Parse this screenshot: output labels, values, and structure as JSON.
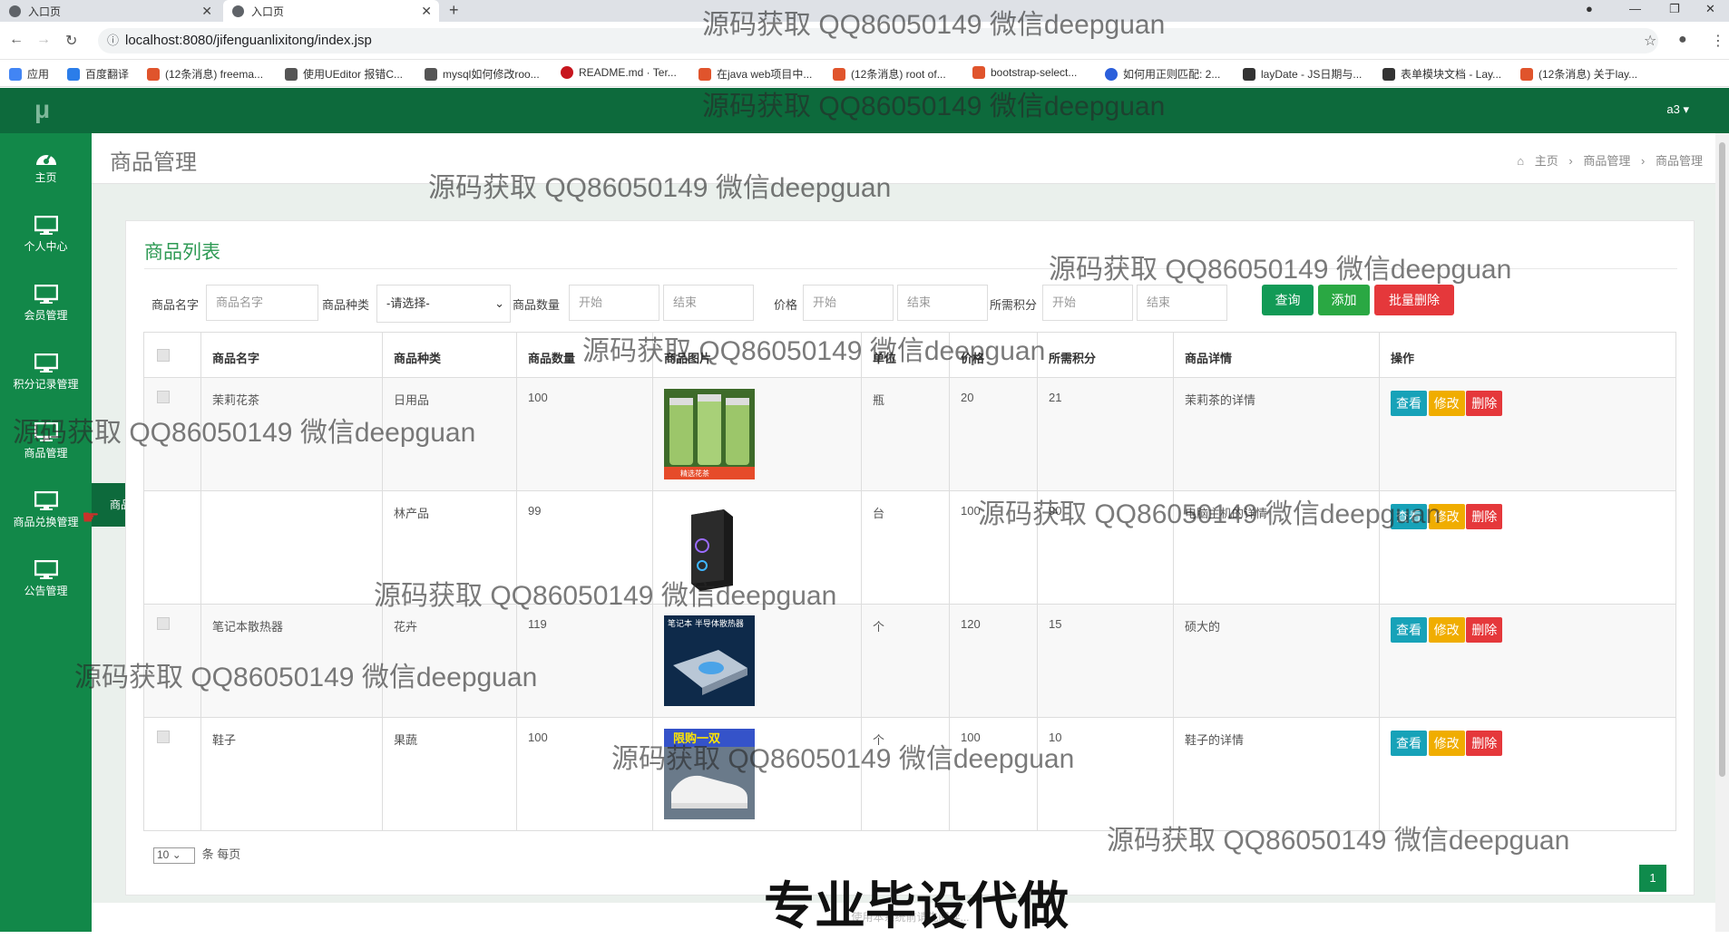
{
  "browser": {
    "tabs": [
      {
        "label": "入口页"
      },
      {
        "label": "入口页"
      }
    ],
    "url": "localhost:8080/jifenguanlixitong/index.jsp",
    "bookmarks": [
      {
        "label": "应用"
      },
      {
        "label": "百度翻译"
      },
      {
        "label": "(12条消息) freema..."
      },
      {
        "label": "使用UEditor 报错C..."
      },
      {
        "label": "mysql如何修改roo..."
      },
      {
        "label": "README.md · Ter..."
      },
      {
        "label": "在java web项目中..."
      },
      {
        "label": "(12条消息) root of..."
      },
      {
        "label": "bootstrap-select..."
      },
      {
        "label": "如何用正则匹配: 2..."
      },
      {
        "label": "layDate - JS日期与..."
      },
      {
        "label": "表单模块文档 - Lay..."
      },
      {
        "label": "(12条消息) 关于lay..."
      }
    ]
  },
  "app": {
    "logo": "μ",
    "user": "a3 ▾",
    "sidebar": [
      {
        "label": "主页",
        "icon": "dashboard-icon"
      },
      {
        "label": "个人中心",
        "icon": "monitor-icon"
      },
      {
        "label": "会员管理",
        "icon": "monitor-icon"
      },
      {
        "label": "积分记录管理",
        "icon": "monitor-icon"
      },
      {
        "label": "商品管理",
        "icon": "monitor-icon"
      },
      {
        "label": "商品兑换管理",
        "icon": "monitor-icon"
      },
      {
        "label": "公告管理",
        "icon": "monitor-icon"
      }
    ],
    "flyout": "商品兑换管理",
    "page_title": "商品管理",
    "breadcrumb": [
      "主页",
      "商品管理",
      "商品管理"
    ]
  },
  "panel": {
    "title": "商品列表",
    "filters": {
      "name_label": "商品名字",
      "name_placeholder": "商品名字",
      "type_label": "商品种类",
      "type_value": "-请选择-",
      "qty_label": "商品数量",
      "price_label": "价格",
      "points_label": "所需积分",
      "start": "开始",
      "end": "结束"
    },
    "buttons": {
      "query": "查询",
      "add": "添加",
      "batch_delete": "批量删除"
    },
    "columns": [
      "商品名字",
      "商品种类",
      "商品数量",
      "商品图片",
      "单位",
      "价格",
      "所需积分",
      "商品详情",
      "操作"
    ],
    "rows": [
      {
        "name": "茉莉花茶",
        "type": "日用品",
        "qty": "100",
        "image": "jar-image",
        "unit": "瓶",
        "price": "20",
        "points": "21",
        "detail": "茉莉茶的详情"
      },
      {
        "name": "",
        "type": "林产品",
        "qty": "99",
        "image": "pc-case-image",
        "unit": "台",
        "price": "100",
        "points": "90",
        "detail": "电脑主机的详情"
      },
      {
        "name": "笔记本散热器",
        "type": "花卉",
        "qty": "119",
        "image": "cooler-image",
        "unit": "个",
        "price": "120",
        "points": "15",
        "detail": "硕大的"
      },
      {
        "name": "鞋子",
        "type": "果蔬",
        "qty": "100",
        "image": "shoe-image",
        "unit": "个",
        "price": "100",
        "points": "10",
        "detail": "鞋子的详情"
      }
    ],
    "actions": {
      "view": "查看",
      "edit": "修改",
      "delete": "删除"
    },
    "pager": {
      "page_size": "10",
      "suffix": "条 每页",
      "current_page": "1"
    }
  },
  "footer": "使用本系统前请先阅读...",
  "watermarks": {
    "text": "源码获取 QQ86050149 微信deepguan",
    "banner": "专业毕设代做"
  },
  "image_text": {
    "cooler": "笔记本 半导体散热器",
    "shoe": "限购一双",
    "jar": "精选花茶"
  }
}
